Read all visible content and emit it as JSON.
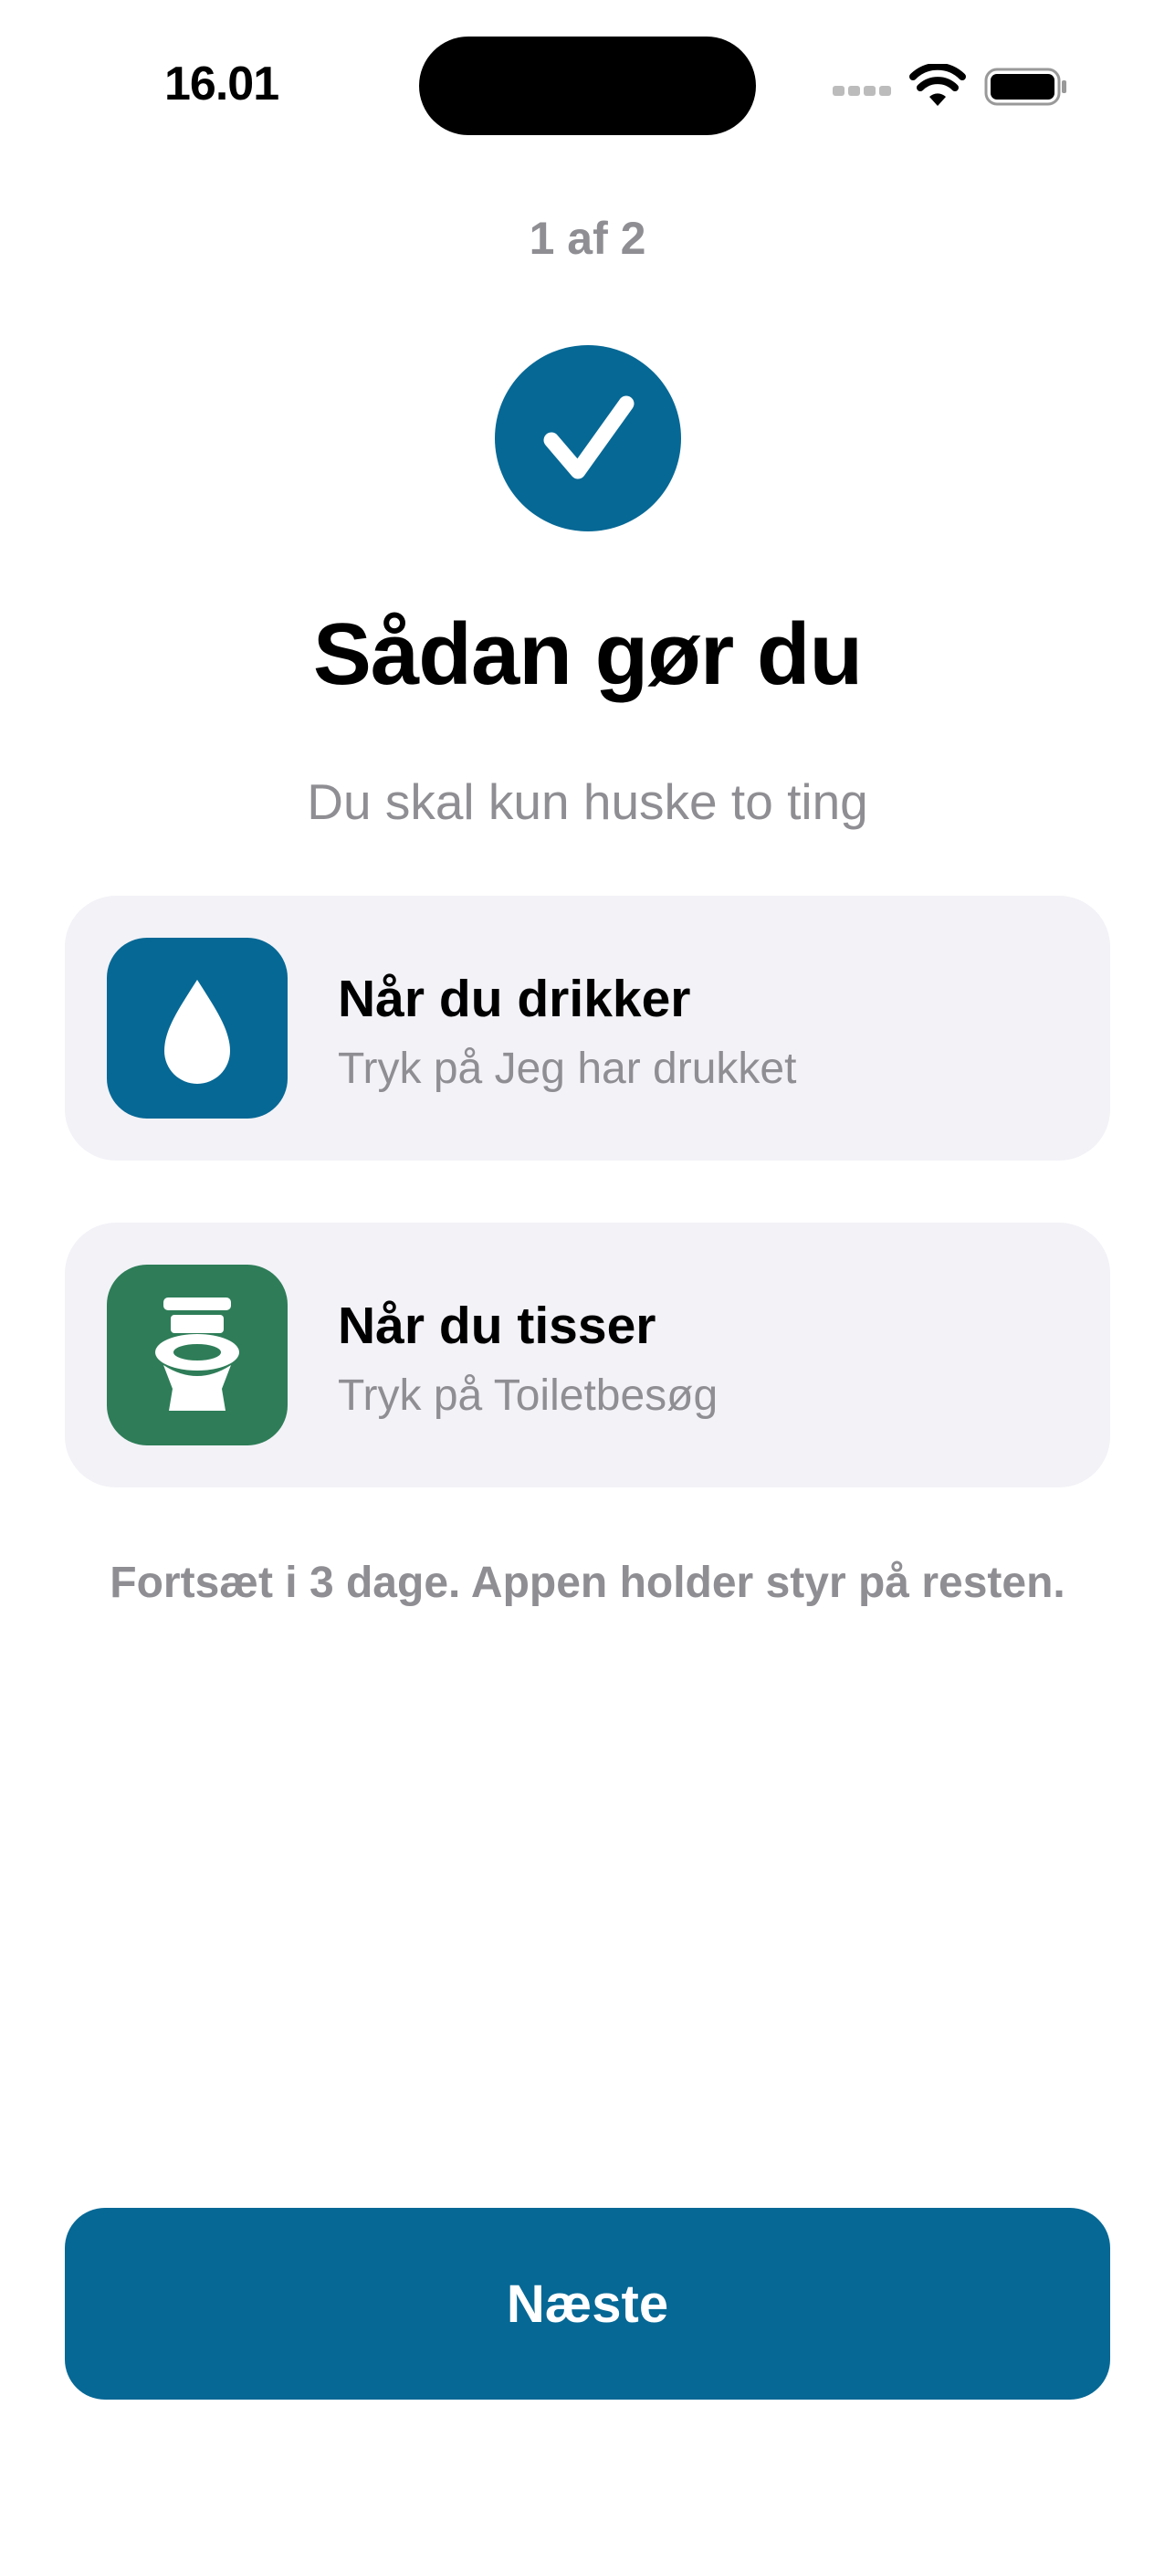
{
  "status_bar": {
    "time": "16.01"
  },
  "onboarding": {
    "step": "1 af 2",
    "title": "Sådan gør du",
    "subtitle": "Du skal kun huske to ting",
    "cards": [
      {
        "icon": "water-drop-icon",
        "icon_color": "#066895",
        "title": "Når du drikker",
        "subtitle": "Tryk på Jeg har drukket"
      },
      {
        "icon": "toilet-icon",
        "icon_color": "#2e7d58",
        "title": "Når du tisser",
        "subtitle": "Tryk på Toiletbesøg"
      }
    ],
    "footnote": "Fortsæt i 3 dage. Appen holder styr på resten.",
    "next_label": "Næste"
  },
  "colors": {
    "accent": "#066895",
    "green": "#2e7d58",
    "card_bg": "#f2f2f7",
    "secondary_text": "#8e8e93"
  }
}
